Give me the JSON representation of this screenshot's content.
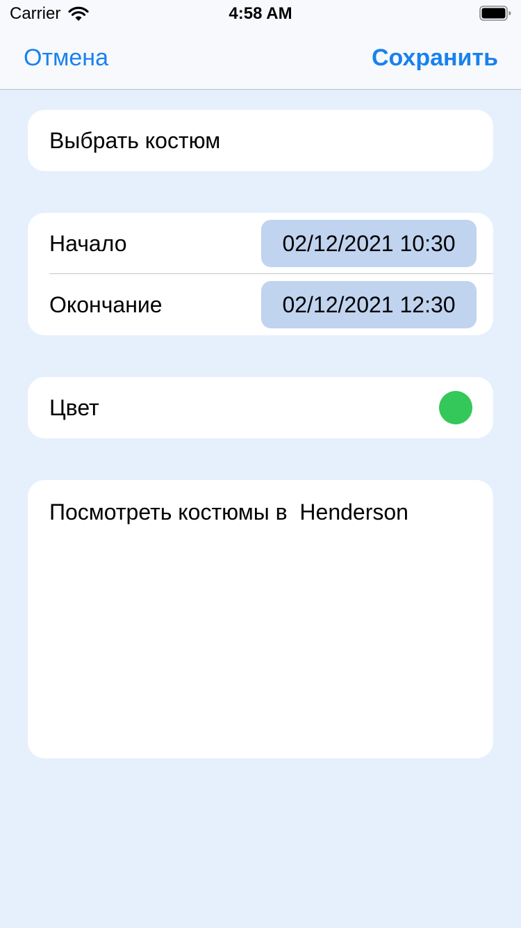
{
  "status_bar": {
    "carrier": "Carrier",
    "time": "4:58 AM",
    "wifi_icon": "wifi-icon",
    "battery_icon": "battery-icon"
  },
  "nav": {
    "cancel_label": "Отмена",
    "save_label": "Сохранить",
    "accent_color": "#1882ee"
  },
  "form": {
    "costume_label": "Выбрать костюм",
    "start_label": "Начало",
    "start_value": "02/12/2021 10:30",
    "end_label": "Окончание",
    "end_value": "02/12/2021 12:30",
    "color_label": "Цвет",
    "color_value": "#34c759",
    "note_text": "Посмотреть костюмы в  Henderson"
  },
  "colors": {
    "background": "#e5f0fc",
    "card": "#ffffff",
    "date_pill": "#c0d3ef"
  }
}
